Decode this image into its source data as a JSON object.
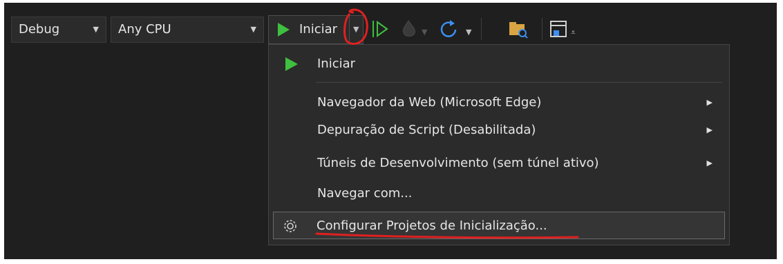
{
  "toolbar": {
    "config_combo": {
      "value": "Debug"
    },
    "platform_combo": {
      "value": "Any CPU"
    },
    "run_button": {
      "label": "Iniciar"
    }
  },
  "menu": {
    "items": [
      {
        "label": "Iniciar",
        "icon": "play-icon"
      },
      {
        "label": "Navegador da Web (Microsoft Edge)",
        "submenu": true
      },
      {
        "label": "Depuração de Script (Desabilitada)",
        "submenu": true
      },
      {
        "label": "Túneis de Desenvolvimento (sem túnel ativo)",
        "submenu": true
      },
      {
        "label": "Navegar com...",
        "submenu": false
      },
      {
        "label": "Configurar Projetos de Inicialização...",
        "icon": "gear-icon",
        "highlighted": true
      }
    ]
  },
  "colors": {
    "background": "#1f1f1f",
    "menu_bg": "#2b2b2b",
    "play_green": "#3fbf3f",
    "annotation_red": "#e02020"
  }
}
